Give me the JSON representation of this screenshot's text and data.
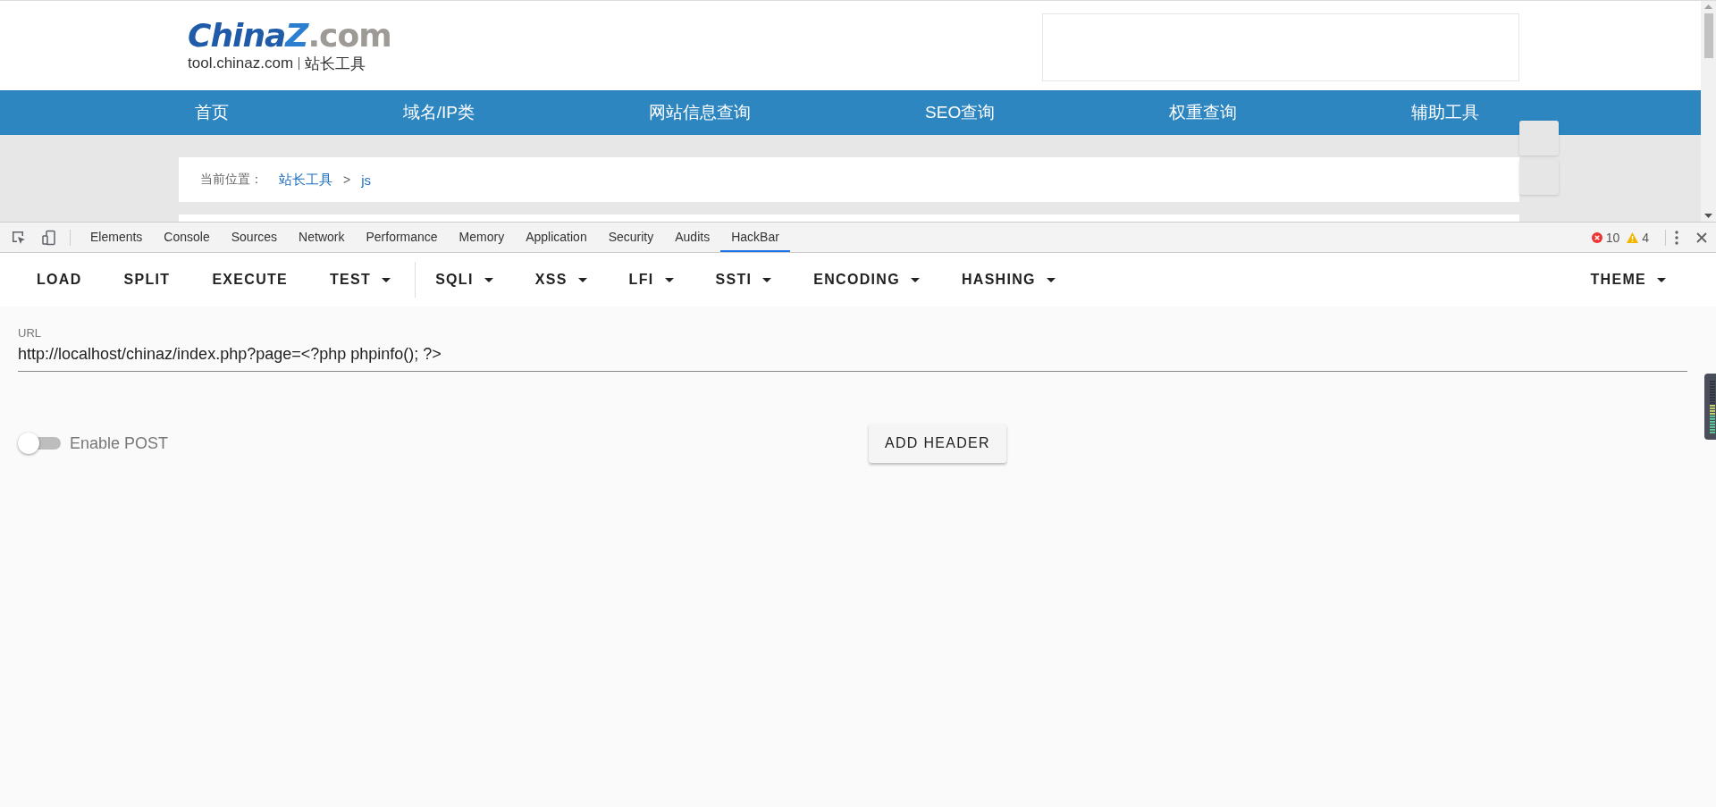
{
  "site": {
    "logo": {
      "brand_main": "China",
      "brand_mark": "Z",
      "brand_suffix": ".com",
      "domain": "tool.chinaz.com",
      "tagline": "站长工具"
    },
    "nav": [
      {
        "label": "首页"
      },
      {
        "label": "域名/IP类"
      },
      {
        "label": "网站信息查询"
      },
      {
        "label": "SEO查询"
      },
      {
        "label": "权重查询"
      },
      {
        "label": "辅助工具"
      }
    ],
    "breadcrumb": {
      "prefix": "当前位置：",
      "links": [
        "站长工具",
        "js"
      ],
      "separator": ">"
    }
  },
  "devtools": {
    "tabs": [
      {
        "label": "Elements",
        "selected": false
      },
      {
        "label": "Console",
        "selected": false
      },
      {
        "label": "Sources",
        "selected": false
      },
      {
        "label": "Network",
        "selected": false
      },
      {
        "label": "Performance",
        "selected": false
      },
      {
        "label": "Memory",
        "selected": false
      },
      {
        "label": "Application",
        "selected": false
      },
      {
        "label": "Security",
        "selected": false
      },
      {
        "label": "Audits",
        "selected": false
      },
      {
        "label": "HackBar",
        "selected": true
      }
    ],
    "errors": "10",
    "warnings": "4"
  },
  "hackbar": {
    "toolbar": [
      {
        "label": "LOAD",
        "kind": "button"
      },
      {
        "label": "SPLIT",
        "kind": "button"
      },
      {
        "label": "EXECUTE",
        "kind": "button"
      },
      {
        "label": "TEST",
        "kind": "menu"
      },
      {
        "kind": "divider"
      },
      {
        "label": "SQLI",
        "kind": "menu"
      },
      {
        "label": "XSS",
        "kind": "menu"
      },
      {
        "label": "LFI",
        "kind": "menu"
      },
      {
        "label": "SSTI",
        "kind": "menu"
      },
      {
        "label": "ENCODING",
        "kind": "menu"
      },
      {
        "label": "HASHING",
        "kind": "menu"
      },
      {
        "kind": "spacer"
      },
      {
        "label": "THEME",
        "kind": "menu"
      }
    ],
    "url": {
      "label": "URL",
      "value": "http://localhost/chinaz/index.php?page=<?php phpinfo(); ?>"
    },
    "enable_post": {
      "label": "Enable POST",
      "on": false
    },
    "add_header": "ADD HEADER"
  }
}
